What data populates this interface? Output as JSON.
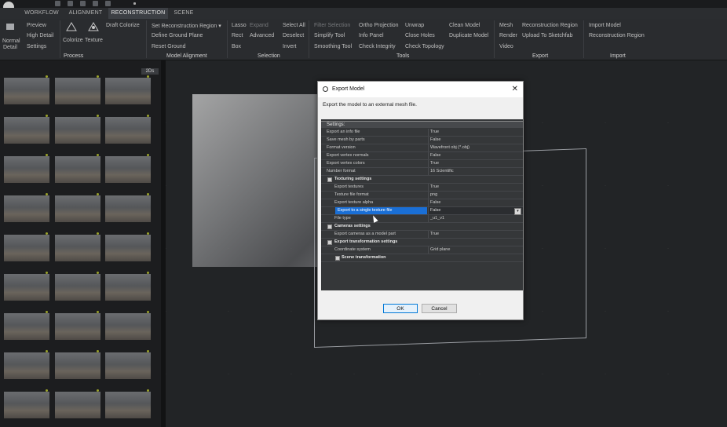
{
  "tabs": [
    "WORKFLOW",
    "ALIGNMENT",
    "RECONSTRUCTION",
    "SCENE"
  ],
  "active_tab": "RECONSTRUCTION",
  "ribbon": {
    "detail": {
      "normal": "Normal",
      "detail": "Detail",
      "preview": "Preview",
      "high_detail": "High Detail",
      "settings": "Settings"
    },
    "process": {
      "colorize": "Colorize",
      "texture": "Texture",
      "draft_colorize": "Draft Colorize",
      "label": "Process"
    },
    "model_alignment": {
      "set_region": "Set Reconstruction Region",
      "define_ground": "Define Ground Plane",
      "reset_ground": "Reset Ground",
      "label": "Model Alignment"
    },
    "selection": {
      "lasso": "Lasso",
      "rect": "Rect",
      "box": "Box",
      "expand": "Expand",
      "advanced": "Advanced",
      "select_all": "Select All",
      "deselect": "Deselect",
      "invert": "Invert",
      "label": "Selection"
    },
    "tools": {
      "filter_selection": "Filter Selection",
      "simplify_tool": "Simplify Tool",
      "smoothing_tool": "Smoothing Tool",
      "ortho_projection": "Ortho Projection",
      "info_panel": "Info Panel",
      "check_integrity": "Check Integrity",
      "unwrap": "Unwrap",
      "close_holes": "Close Holes",
      "check_topology": "Check Topology",
      "clean_model": "Clean Model",
      "duplicate_model": "Duplicate Model",
      "label": "Tools"
    },
    "export": {
      "mesh": "Mesh",
      "render": "Render",
      "video": "Video",
      "reconstruction_region": "Reconstruction Region",
      "upload_sketchfab": "Upload To Sketchfab",
      "label": "Export"
    },
    "import": {
      "import_model": "Import Model",
      "reconstruction_region": "Reconstruction Region",
      "label": "Import"
    }
  },
  "panel": {
    "header_badge": "2Ds"
  },
  "dialog": {
    "title": "Export Model",
    "description": "Export the model to an external mesh file.",
    "settings_header": "Settings:",
    "rows": [
      {
        "k": "Export an info file",
        "v": "True"
      },
      {
        "k": "Save mesh by parts",
        "v": "False"
      },
      {
        "k": "Format version",
        "v": "Wavefront obj (*.obj)"
      },
      {
        "k": "Export vertex normals",
        "v": "False"
      },
      {
        "k": "Export vertex colors",
        "v": "True"
      },
      {
        "k": "Number format",
        "v": "16 Scientific"
      }
    ],
    "texturing": {
      "title": "Texturing settings",
      "rows": [
        {
          "k": "Export textures",
          "v": "True"
        },
        {
          "k": "Texture file format",
          "v": "png"
        },
        {
          "k": "Export texture alpha",
          "v": "False"
        },
        {
          "k": "Export to a single texture file",
          "v": "False"
        },
        {
          "k": "File type",
          "v": "_u1_v1"
        }
      ]
    },
    "cameras": {
      "title": "Cameras settings",
      "rows": [
        {
          "k": "Export cameras as a model part",
          "v": "True"
        }
      ]
    },
    "transformation": {
      "title": "Export transformation settings",
      "rows": [
        {
          "k": "Coordinate system",
          "v": "Grid plane"
        }
      ],
      "sub": "Scene transformation"
    },
    "ok": "OK",
    "cancel": "Cancel"
  },
  "colors": {
    "accent": "#1a6fd6",
    "panel": "#1c1d1f",
    "ribbon": "#2a2c2f"
  }
}
